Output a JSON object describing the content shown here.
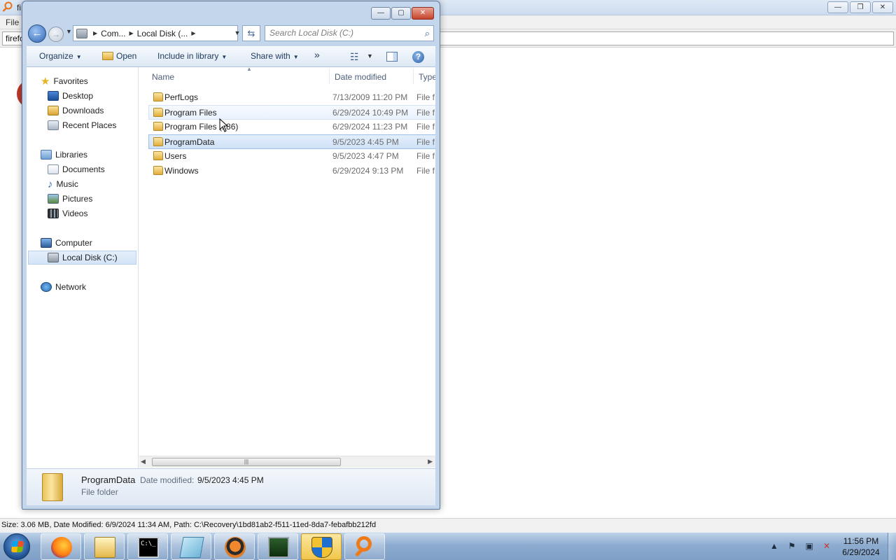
{
  "background_app": {
    "title": "fi",
    "menu_file": "File",
    "search_value": "firefo",
    "win_buttons": [
      "—",
      "❐",
      "✕"
    ],
    "status_text": "Size: 3.06 MB, Date Modified: 6/9/2024 11:34 AM, Path: C:\\Recovery\\1bd81ab2-f511-11ed-8da7-febafbb212fd"
  },
  "explorer": {
    "win_buttons": [
      "—",
      "▢",
      "✕"
    ],
    "nav": {
      "back_icon": "←",
      "forward_icon": "→",
      "recent_icon": "▼"
    },
    "address": {
      "crumbs": [
        "Com...",
        "Local Disk (..."
      ],
      "dropdown_icon": "▼",
      "refresh_icon": "⇆"
    },
    "search": {
      "placeholder": "Search Local Disk (C:)",
      "icon": "⌕"
    },
    "cmdbar": {
      "organize": "Organize",
      "open": "Open",
      "include_in_library": "Include in library",
      "share_with": "Share with",
      "more": "»",
      "views_icon": "☷",
      "help_icon": "?"
    },
    "navpane": {
      "favorites": "Favorites",
      "desktop": "Desktop",
      "downloads": "Downloads",
      "recent_places": "Recent Places",
      "libraries": "Libraries",
      "documents": "Documents",
      "music": "Music",
      "pictures": "Pictures",
      "videos": "Videos",
      "computer": "Computer",
      "local_disk": "Local Disk (C:)",
      "network": "Network"
    },
    "columns": {
      "name": "Name",
      "date_modified": "Date modified",
      "type": "Type"
    },
    "files": [
      {
        "name": "PerfLogs",
        "date": "7/13/2009 11:20 PM",
        "type": "File f"
      },
      {
        "name": "Program Files",
        "date": "6/29/2024 10:49 PM",
        "type": "File f"
      },
      {
        "name": "Program Files (x86)",
        "date": "6/29/2024 11:23 PM",
        "type": "File f"
      },
      {
        "name": "ProgramData",
        "date": "9/5/2023 4:45 PM",
        "type": "File f"
      },
      {
        "name": "Users",
        "date": "9/5/2023 4:47 PM",
        "type": "File f"
      },
      {
        "name": "Windows",
        "date": "6/29/2024 9:13 PM",
        "type": "File f"
      }
    ],
    "scrollbar": {
      "left": "◀",
      "right": "▶",
      "grip": "|||"
    },
    "details": {
      "name": "ProgramData",
      "date_label": "Date modified:",
      "date_value": "9/5/2023 4:45 PM",
      "type": "File folder"
    }
  },
  "taskbar": {
    "clock_time": "11:56 PM",
    "clock_date": "6/29/2024",
    "cmd_glyph": "C:\\_",
    "tray_icons": [
      "▲",
      "⚑",
      "▣",
      "✕"
    ]
  }
}
